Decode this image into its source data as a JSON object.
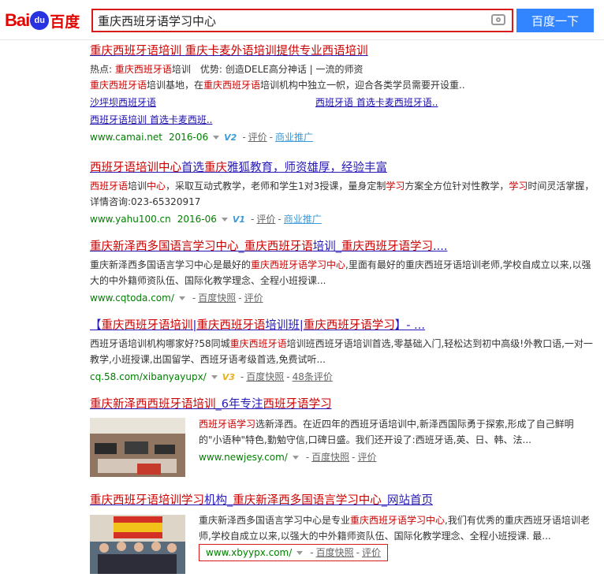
{
  "header": {
    "logo_text": "Bai",
    "logo_paw": "du",
    "logo_cn": "百度",
    "search_value": "重庆西班牙语学习中心",
    "search_button": "百度一下"
  },
  "results": [
    {
      "title_parts": [
        "重庆西班牙语培训",
        " ",
        "重庆",
        "卡麦外语培训提供专业西语培训"
      ],
      "line1_parts": [
        "热点: ",
        "重庆西班牙语",
        "培训",
        "　优势: 创造DELE高分神话 | 一流的师资"
      ],
      "line2_parts": [
        "重庆西班牙语",
        "培训基地，在",
        "重庆西班牙语",
        "培训机构中独立一帜，迎合各类学员需要开设重.."
      ],
      "sub1": "沙坪坝西班牙语",
      "sub2": "西班牙语 首选卡麦西班牙语..",
      "sub3": "西班牙语培训 首选卡麦西班..",
      "url": "www.camai.net",
      "date": "2016-06",
      "v": "V2",
      "rate": "评价",
      "ad": "商业推广"
    },
    {
      "title_parts": [
        "西班牙语培训中心",
        "首选",
        "重庆",
        "雅狐教育，师资雄厚，经验丰富"
      ],
      "desc_parts": [
        "西班牙语",
        "培训",
        "中心",
        "，采取互动式教学，老师和学生1对3授课，量身定制",
        "学习",
        "方案全方位针对性教学，",
        "学习",
        "时间灵活掌握，详情咨询:023-65320917"
      ],
      "url": "www.yahu100.cn",
      "date": "2016-06",
      "v": "V1",
      "rate": "评价",
      "ad": "商业推广"
    },
    {
      "title_parts": [
        "重庆新泽西多国语言",
        "学习中心",
        "_",
        "重庆西班牙语",
        "培训_",
        "重庆西班牙语学习",
        "...."
      ],
      "desc_parts": [
        "重庆新泽西多国语言学习中心是最好的",
        "重庆西班牙语学习中心",
        ",里面有最好的重庆西班牙语培训老师,学校自成立以来,以强大的中外籍师资队伍、国际化教学理念、全程小班授课..."
      ],
      "url": "www.cqtoda.com/",
      "snapshot": "百度快照",
      "rate": "评价"
    },
    {
      "title_parts": [
        "【",
        "重庆西班牙语培训",
        "|",
        "重庆西班牙语",
        "培训班|",
        "重庆西班牙语学习",
        "】- ..."
      ],
      "desc_parts": [
        "西班牙语培训机构哪家好?58同城",
        "重庆西班牙语",
        "培训班西班牙语培训首选,零基础入门,轻松达到初中高级!外教口语,一对一教学,小班授课,出国留学、西班牙语考级首选,免费试听..."
      ],
      "url": "cq.58.com/xibanyayupx/",
      "v": "V3",
      "snapshot": "百度快照",
      "reviews": "48条评价"
    },
    {
      "title_parts": [
        "重庆新泽西西班牙语培训",
        "_6年专注",
        "西班牙语学习"
      ],
      "desc_parts": [
        "西班牙语学习",
        "选新泽西。在近四年的西班牙语培训中,新泽西国际勇于探索,形成了自己鲜明的\"小语种\"特色,勤勉守信,口碑日盛。我们还开设了:西班牙语,英、日、韩、法..."
      ],
      "url": "www.newjesy.com/",
      "snapshot": "百度快照",
      "rate": "评价"
    },
    {
      "title_parts": [
        "重庆西班牙语培训",
        "学习",
        "机构_",
        "重庆新泽西多国语言",
        "学习中心",
        "_网站首页"
      ],
      "desc_parts": [
        "重庆新泽西多国语言学习中心是专业",
        "重庆西班牙语学习中心",
        ",我们有优秀的重庆西班牙语培训老师,学校自成立以来,以强大的中外籍师资队伍、国际化教学理念、全程小班授课. 最..."
      ],
      "url": "www.xbyypx.com/",
      "snapshot": "百度快照",
      "rate": "评价"
    }
  ],
  "colors": {
    "accent": "#3385ff",
    "brand_red": "#e10601",
    "link": "#2518b5",
    "highlight": "#cc0000",
    "url_green": "#008000"
  }
}
